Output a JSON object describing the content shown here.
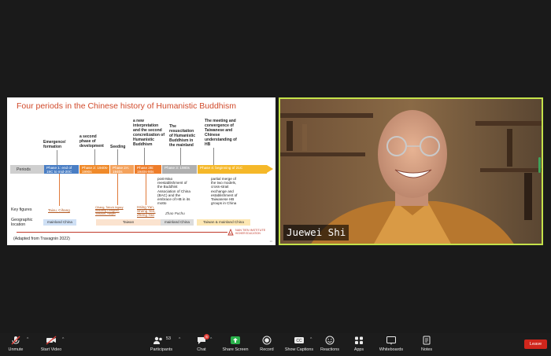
{
  "slide": {
    "title": "Four periods in the Chinese history of Humanistic Buddhism",
    "periods_label": "Periods",
    "phase_heads": [
      "Emergence/\nformation",
      "a second\nphase of\ndevelopment",
      "Seeding",
      "a new\ninterpretation\nand the second\nconcretization of\nHumanistic\nBuddhism",
      "The\nresuscitation\nof Humanistic\nBuddhism in\nthe mainland",
      "The meeting and\nconvergence of\nTaiwanese and\nChinese\nunderstanding of\nHB"
    ],
    "segments": [
      "Phase 1: end of\n19C to mid-20C",
      "Phase 2: 1940s-\n1990s",
      "Phase 2A:\n1940s",
      "Phase 2B:\n1940s-90s",
      "Phase 3: 1980s",
      "Phase 4: beginning of 21C"
    ],
    "notes": {
      "phase3": "post-Mao\nreestablishment of\nthe Buddhist\nAssociation of China\n(BAC) and the\nembrace of HB in its\nmotto",
      "phase4": "partial merge of\nthe two models,\ncross-strait\nexchange and\nestablishment of\nTaiwanese HB\ngroups in China"
    },
    "key_figures_label": "Key figures",
    "figures": {
      "phase1": "Taixu, Cihang",
      "phase2a": "Cihang, Taixu's legacy\nincluding Dongchu,\nYinshun, Yanpei",
      "phase2b": "Hsing Yun,\nSheng Yen,\nZheng Yan",
      "phase3": "Zhao Puchu"
    },
    "geo_label": "Geographic\nlocation",
    "locations": [
      "mainland China",
      "Taiwan",
      "mainland China",
      "Taiwan & mainland China"
    ],
    "source": "(Adapted from Travagnin 2022)",
    "logo_line1": "NAN TIEN INSTITUTE",
    "logo_line2": "HIGHER EDUCATION",
    "page_number": "20"
  },
  "participant": {
    "name": "Juewei Shi"
  },
  "toolbar": {
    "unmute": "Unmute",
    "start_video": "Start Video",
    "participants": "Participants",
    "participants_count": "53",
    "chat": "Chat",
    "chat_badge": "6",
    "share_screen": "Share Screen",
    "record": "Record",
    "show_captions": "Show Captions",
    "reactions": "Reactions",
    "apps": "Apps",
    "whiteboards": "Whiteboards",
    "notes": "Notes",
    "leave": "Leave"
  },
  "colors": {
    "accent_green": "#c4e24a",
    "share_green": "#2bb24c",
    "leave_red": "#d0261c",
    "phase1_blue": "#4a7ec4",
    "phase_orange": "#f08a2a",
    "phase3_grey": "#b0b0b0",
    "phase4_gold": "#f5b829"
  }
}
